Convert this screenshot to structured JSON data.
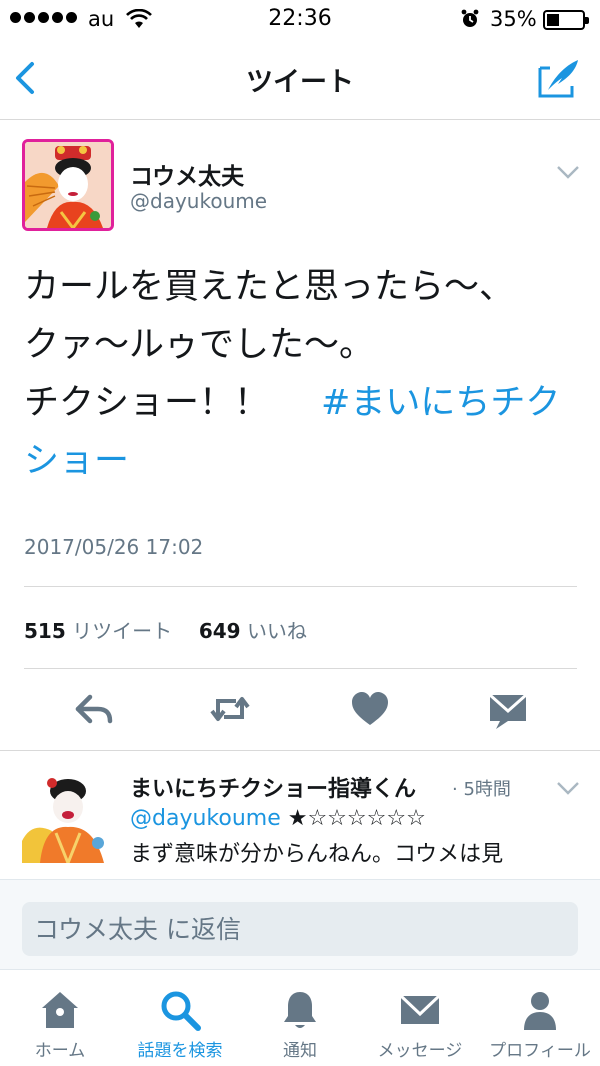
{
  "status_bar": {
    "carrier": "au",
    "time": "22:36",
    "battery_percent": "35%",
    "battery_level": 0.35
  },
  "nav": {
    "title": "ツイート",
    "back_icon": "chevron-left-icon",
    "compose_icon": "compose-tweet-icon"
  },
  "tweet": {
    "author_name": "コウメ太夫",
    "author_handle": "@dayukoume",
    "text_line1": "カールを買えたと思ったら〜、",
    "text_line2": "クァ〜ルゥでした〜。",
    "text_line3": "チクショー！！",
    "hashtag": "#まいにちチクショー",
    "timestamp": "2017/05/26 17:02",
    "retweet_count": "515",
    "retweet_label": "リツイート",
    "like_count": "649",
    "like_label": "いいね"
  },
  "actions": {
    "icons": [
      "reply-icon",
      "retweet-icon",
      "like-heart-icon",
      "direct-message-icon"
    ]
  },
  "reply": {
    "name": "まいにちチクショー指導くん",
    "time": "· 5時間",
    "mention": "@dayukoume",
    "rating": "★☆☆☆☆☆☆",
    "text": "まず意味が分からんねん。コウメは見"
  },
  "composer": {
    "placeholder": "コウメ太夫 に返信"
  },
  "tab_bar": {
    "items": [
      {
        "label": "ホーム",
        "icon": "home-icon",
        "active": false
      },
      {
        "label": "話題を検索",
        "icon": "search-icon",
        "active": true
      },
      {
        "label": "通知",
        "icon": "bell-icon",
        "active": false
      },
      {
        "label": "メッセージ",
        "icon": "envelope-icon",
        "active": false
      },
      {
        "label": "プロフィール",
        "icon": "person-icon",
        "active": false
      }
    ]
  },
  "colors": {
    "accent": "#1b95e0",
    "secondary_text": "#657786",
    "icon_gray": "#657786"
  }
}
